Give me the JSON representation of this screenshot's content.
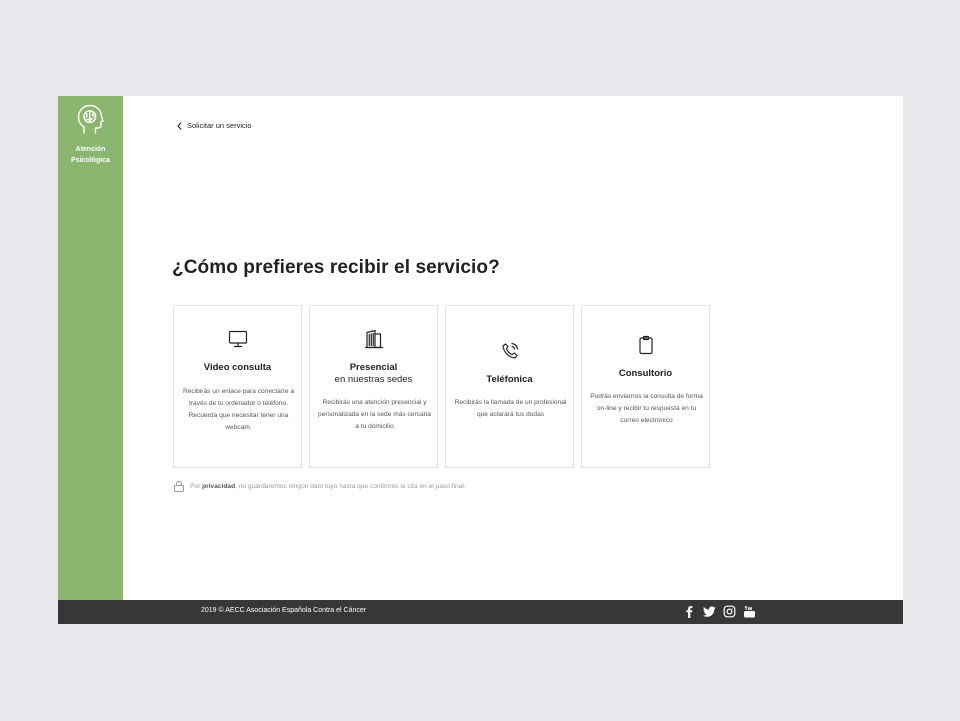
{
  "sidebar": {
    "brand_label": "Atención Psicológica",
    "brand_icon": "head-brain-icon",
    "bg_color": "#8bb66f"
  },
  "nav": {
    "back_label": "Solicitar un servicio"
  },
  "main": {
    "title": "¿Cómo prefieres recibir el servicio?",
    "cards": [
      {
        "icon": "monitor-icon",
        "title": "Video consulta",
        "subtitle": "",
        "description": "Recibirás un enlace para conectarte a través de tu ordenador o teléfono. Recuerda que necesitar tener una webcam."
      },
      {
        "icon": "building-icon",
        "title": "Presencial",
        "subtitle": "en nuestras sedes",
        "description": "Recibirás una atención presencial y personalizada en la sede más cercana a tu domicilio"
      },
      {
        "icon": "phone-call-icon",
        "title": "Teléfonica",
        "subtitle": "",
        "description": "Recibirás la llamada de un profesional que aclarará tus dudas"
      },
      {
        "icon": "clipboard-icon",
        "title": "Consultorio",
        "subtitle": "",
        "description": "Podrás enviarnos la consulta de forma on-line y recibir tu respuesta en tu correo electrónico"
      }
    ],
    "privacy": {
      "prefix": "Por",
      "bold": "privacidad",
      "suffix": ", no guardaremos ningún dato tuyo hasta que confirmes la cita en el paso final."
    }
  },
  "footer": {
    "copyright": "2019 © AECC Asociación Española Contra el Cáncer",
    "social": [
      "facebook-icon",
      "twitter-icon",
      "instagram-icon",
      "youtube-icon"
    ],
    "bg_color": "#373737"
  }
}
